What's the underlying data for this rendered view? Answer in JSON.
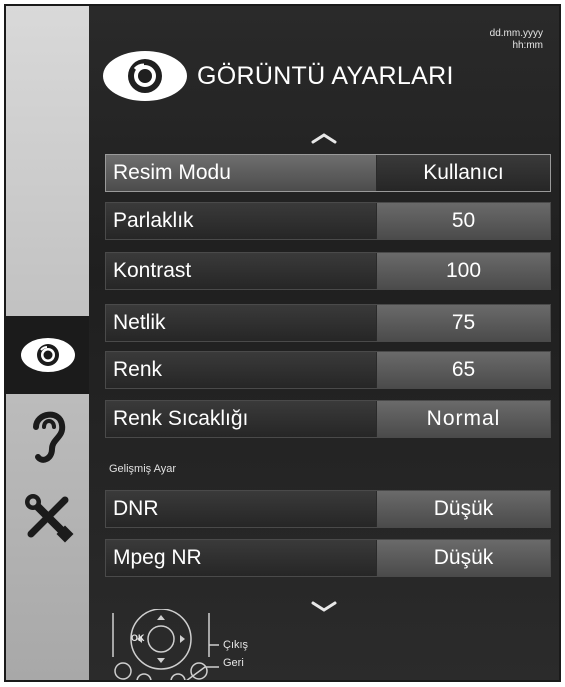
{
  "header": {
    "title": "GÖRÜNTÜ AYARLARI",
    "date": "dd.mm.yyyy",
    "time": "hh:mm"
  },
  "sidebar": {
    "items": [
      {
        "icon": "eye-icon",
        "active": true
      },
      {
        "icon": "ear-icon",
        "active": false
      },
      {
        "icon": "tools-icon",
        "active": false
      }
    ]
  },
  "settings": [
    {
      "label": "Resim Modu",
      "value": "Kullanıcı",
      "selected": true
    },
    {
      "label": "Parlaklık",
      "value": "50"
    },
    {
      "label": "Kontrast",
      "value": "100"
    },
    {
      "label": "Netlik",
      "value": "75"
    },
    {
      "label": "Renk",
      "value": "65"
    },
    {
      "label": "Renk Sıcaklığı",
      "value": "Normal"
    }
  ],
  "advanced": {
    "section_label": "Gelişmiş Ayar",
    "items": [
      {
        "label": "DNR",
        "value": "Düşük"
      },
      {
        "label": "Mpeg NR",
        "value": "Düşük"
      }
    ]
  },
  "footer": {
    "ok_label": "OK",
    "exit_hint": "Çıkış",
    "back_hint": "Geri"
  }
}
